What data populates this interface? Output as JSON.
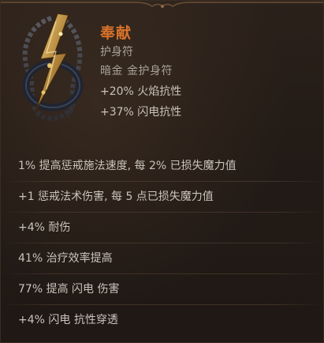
{
  "item": {
    "name": "奉献",
    "item_class": "护身符",
    "base_type": "暗金 金护身符",
    "implicits": [
      "+20% 火焰抗性",
      "+37% 闪电抗性"
    ]
  },
  "mods": [
    "1% 提高惩戒施法速度, 每 2% 已损失魔力值",
    "+1 惩戒法术伤害, 每 5 点已损失魔力值",
    "+4% 耐伤",
    "41% 治疗效率提高",
    "77% 提高 闪电 伤害",
    "+4% 闪电 抗性穿透"
  ],
  "colors": {
    "unique_name": "#d9722b",
    "label": "#a8a29a",
    "mod_text": "#c9c3bb",
    "background": "#231b16"
  },
  "icons": {
    "item_art": "lightning-amulet-icon"
  }
}
